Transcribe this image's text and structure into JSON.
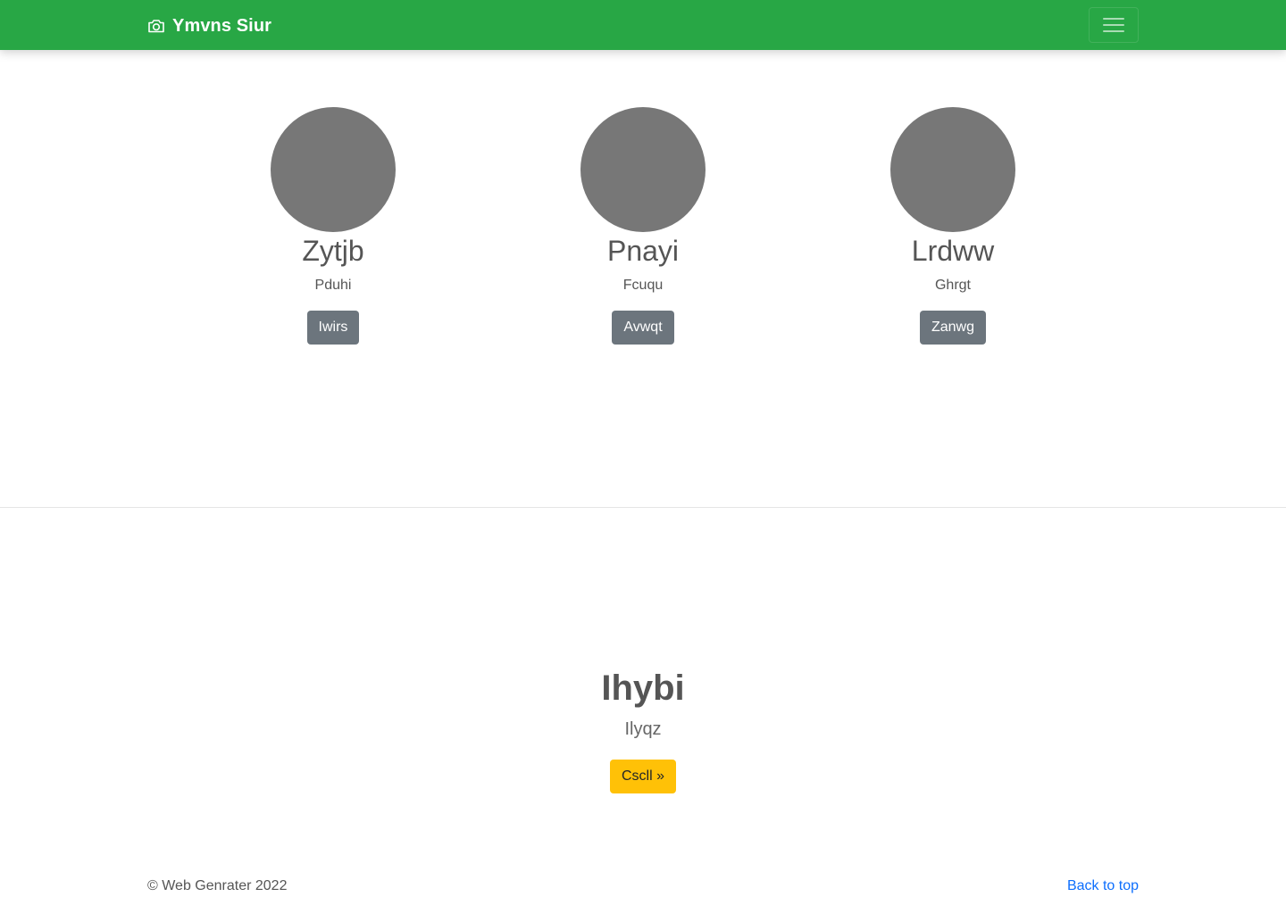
{
  "navbar": {
    "brand": "Ymvns Siur",
    "brand_icon": "camera-icon",
    "toggle_icon": "hamburger-menu-icon",
    "color": "#28a745"
  },
  "team": [
    {
      "name": "Zytjb",
      "role": "Pduhi",
      "button": "Iwirs"
    },
    {
      "name": "Pnayi",
      "role": "Fcuqu",
      "button": "Avwqt"
    },
    {
      "name": "Lrdww",
      "role": "Ghrgt",
      "button": "Zanwg"
    }
  ],
  "feature": {
    "title": "Ihybi",
    "subtitle": "Ilyqz",
    "button": "Cscll »"
  },
  "footer": {
    "copyright": "© Web Genrater 2022",
    "back_to_top": "Back to top"
  },
  "colors": {
    "avatar": "#777777",
    "secondary_button": "#6c757d",
    "warning_button": "#ffc107",
    "link": "#0d6efd"
  }
}
